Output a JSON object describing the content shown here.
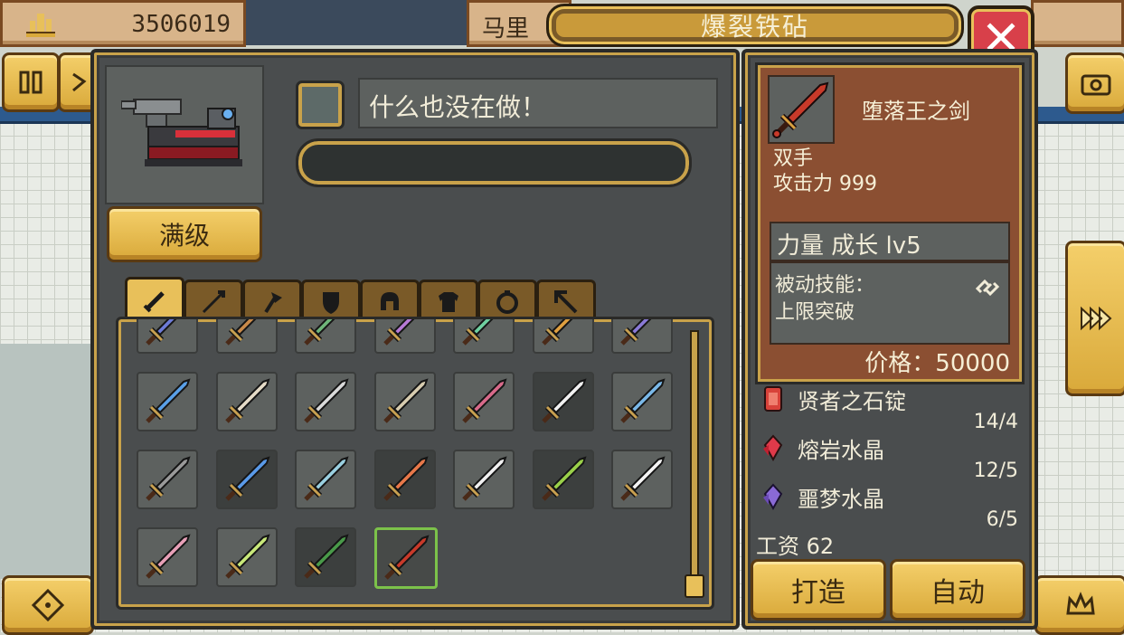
{
  "top": {
    "gold_amount": "3506019",
    "npc_name_partial": "马里",
    "window_title": "爆裂铁砧"
  },
  "forge": {
    "level_button": "满级",
    "status_text": "什么也没在做！",
    "progress": 0,
    "tabs": [
      "sword-tab-icon",
      "spear-tab-icon",
      "axe-tab-icon",
      "shield-tab-icon",
      "helmet-tab-icon",
      "armor-tab-icon",
      "ring-tab-icon",
      "staff-tab-icon"
    ],
    "active_tab": 0
  },
  "grid": {
    "rows": [
      [
        "#6d7bd6",
        "#c98a4a",
        "#6fb57a",
        "#b77ad6",
        "#6fd0a0",
        "#e0a040",
        "#8a7ad6"
      ],
      [
        "#5aa0e8",
        "#e6dcc8",
        "#dadada",
        "#d8cdb0",
        "#d86a8a",
        "#f0f0f0",
        "#7ab8e8"
      ],
      [
        "#9a9a9a",
        "#5a9ae8",
        "#9ad0e0",
        "#e8784a",
        "#f0f0f0",
        "#9ad04a",
        "#f4f4f4"
      ],
      [
        "#e8a0b8",
        "#c8e87a",
        "#4a9a4a",
        "#c83a2a"
      ]
    ],
    "selected": [
      3,
      3
    ]
  },
  "detail": {
    "item_name": "堕落王之剑",
    "hands": "双手",
    "attack": "攻击力 999",
    "stat_line": "力量 成长 lv5",
    "passive_label": "被动技能：",
    "passive_value": "上限突破",
    "price": "价格：50000"
  },
  "materials": [
    {
      "name": "贤者之石锭",
      "count": "14/4",
      "color": "#d8423a",
      "icon": "red-ingot-icon"
    },
    {
      "name": "熔岩水晶",
      "count": "12/5",
      "color": "#e03a4a",
      "icon": "lava-crystal-icon"
    },
    {
      "name": "噩梦水晶",
      "count": "6/5",
      "color": "#8a6ad6",
      "icon": "nightmare-crystal-icon"
    }
  ],
  "wage": "工资 62",
  "buttons": {
    "craft": "打造",
    "auto": "自动"
  },
  "colors": {
    "accent_gold": "#e8c05a",
    "panel_bg": "#4a4d4e",
    "detail_bg": "#8b4f32",
    "selected_border": "#7cc24a"
  }
}
